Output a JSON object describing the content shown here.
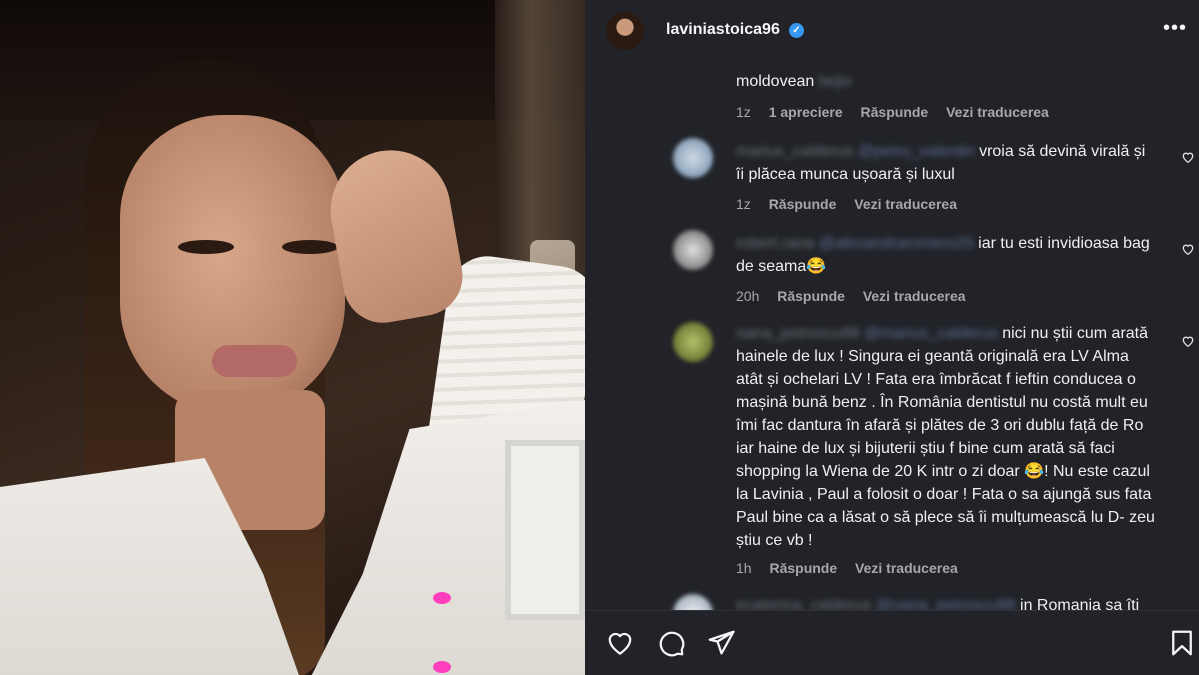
{
  "post": {
    "username": "laviniastoica96",
    "more_icon": "more-horizontal-icon",
    "verified_icon": "verified-badge-icon"
  },
  "comments": [
    {
      "author": "",
      "mention": "",
      "text": "moldovean",
      "text_blurred": "bejiv",
      "time": "1z",
      "likes": "1 apreciere",
      "reply": "Răspunde",
      "translate": "Vezi traducerea"
    },
    {
      "author": "marius_calderus",
      "mention": "@petru_valentin",
      "text": "vroia să devină virală și îi plăcea munca ușoară și luxul",
      "time": "1z",
      "reply": "Răspunde",
      "translate": "Vezi traducerea",
      "avatar_color": "#8aa6c1"
    },
    {
      "author": "robert.rana",
      "mention": "@alexandraromero25",
      "text": "iar tu esti invidioasa bag de seama😂",
      "time": "20h",
      "reply": "Răspunde",
      "translate": "Vezi traducerea",
      "avatar_color": "#9a9a9a"
    },
    {
      "author": "oana_petrescu88",
      "mention": "@marius_calderus",
      "text": "nici nu știi cum arată hainele de lux ! Singura ei geantă originală era LV Alma atât și ochelari LV ! Fata era îmbrăcat f ieftin conducea o mașină bună benz . În România dentistul nu costă mult eu îmi fac dantura în afară și plătes de 3 ori dublu față de Ro iar haine de lux și bijuterii știu f bine cum arată să faci shopping la Wiena de 20 K intr o zi doar 😂! Nu este cazul la Lavinia , Paul a folosit o doar ! Fata o sa ajungă sus fata Paul bine ca a lăsat o să plece să îi mulțumească lu D- zeu știu ce vb !",
      "time": "1h",
      "reply": "Răspunde",
      "translate": "Vezi traducerea",
      "avatar_color": "#7a8a3a"
    },
    {
      "author": "ecaterina_calderus",
      "mention": "@oana_petrescu88",
      "text": "in Romania sa îți",
      "avatar_color": "#c8cfd8"
    }
  ],
  "actions": {
    "like_icon": "heart-icon",
    "comment_icon": "comment-icon",
    "share_icon": "paper-plane-icon",
    "save_icon": "bookmark-icon"
  },
  "colors": {
    "panel_bg": "#212328",
    "text": "#f5f5f5",
    "meta": "#a8a8a8",
    "verified": "#3897f0",
    "photo_accent": "#ff3fbd"
  }
}
